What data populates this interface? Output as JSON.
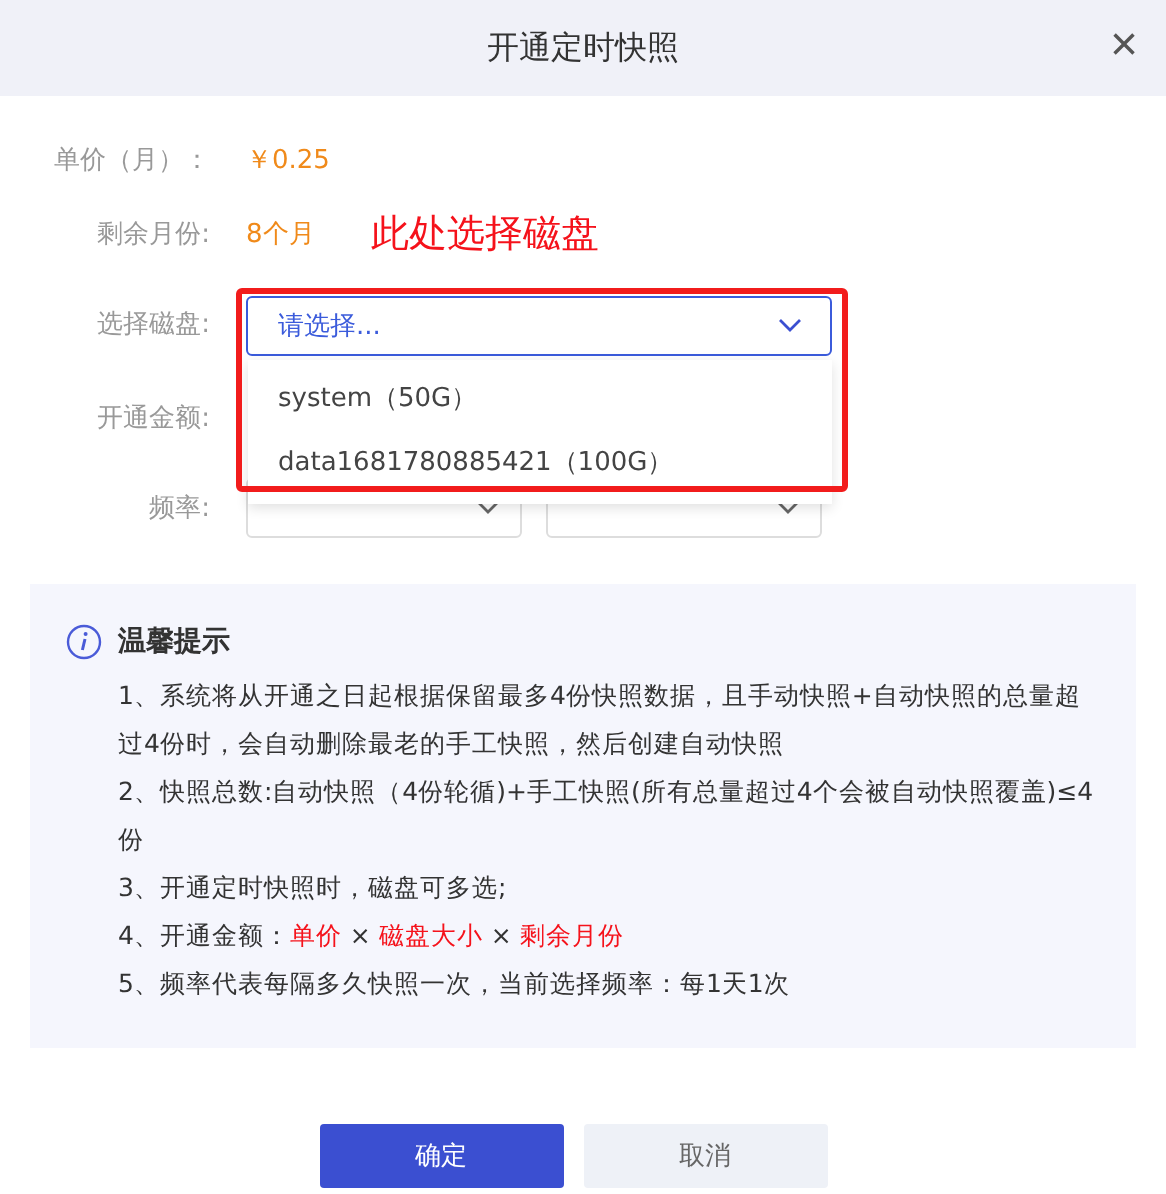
{
  "dialog": {
    "title": "开通定时快照",
    "close": "×"
  },
  "fields": [
    {
      "label": "单价（月）：",
      "value": "￥0.25"
    },
    {
      "label": "剩余月份:",
      "value": "8个月"
    }
  ],
  "annotation": "此处选择磁盘",
  "disk_select": {
    "label": "选择磁盘:",
    "placeholder": "请选择...",
    "options": [
      {
        "text": "system（50G）"
      },
      {
        "text": "data1681780885421（100G）"
      }
    ]
  },
  "amount": {
    "label": "开通金额:"
  },
  "frequency": {
    "label": "频率:"
  },
  "tips": {
    "title": "温馨提示",
    "items": [
      {
        "parts": [
          {
            "text": "1、系统将从开通之日起根据保留最多4份快照数据，且手动快照+自动快照的总量超过4份时，会自动删除最老的手工快照，然后创建自动快照",
            "highlight": false
          }
        ]
      },
      {
        "parts": [
          {
            "text": "2、快照总数:自动快照（4份轮循)+手工快照(所有总量超过4个会被自动快照覆盖)≤4份",
            "highlight": false
          }
        ]
      },
      {
        "parts": [
          {
            "text": "3、开通定时快照时，磁盘可多选;",
            "highlight": false
          }
        ]
      },
      {
        "parts": [
          {
            "text": "4、开通金额：",
            "highlight": false
          },
          {
            "text": "单价",
            "highlight": true
          },
          {
            "text": " × ",
            "highlight": false
          },
          {
            "text": "磁盘大小",
            "highlight": true
          },
          {
            "text": " × ",
            "highlight": false
          },
          {
            "text": "剩余月份",
            "highlight": true
          }
        ]
      },
      {
        "parts": [
          {
            "text": "5、频率代表每隔多久快照一次，当前选择频率：每1天1次",
            "highlight": false
          }
        ]
      }
    ]
  },
  "buttons": [
    {
      "label": "确定",
      "kind": "primary"
    },
    {
      "label": "取消",
      "kind": "secondary"
    }
  ]
}
